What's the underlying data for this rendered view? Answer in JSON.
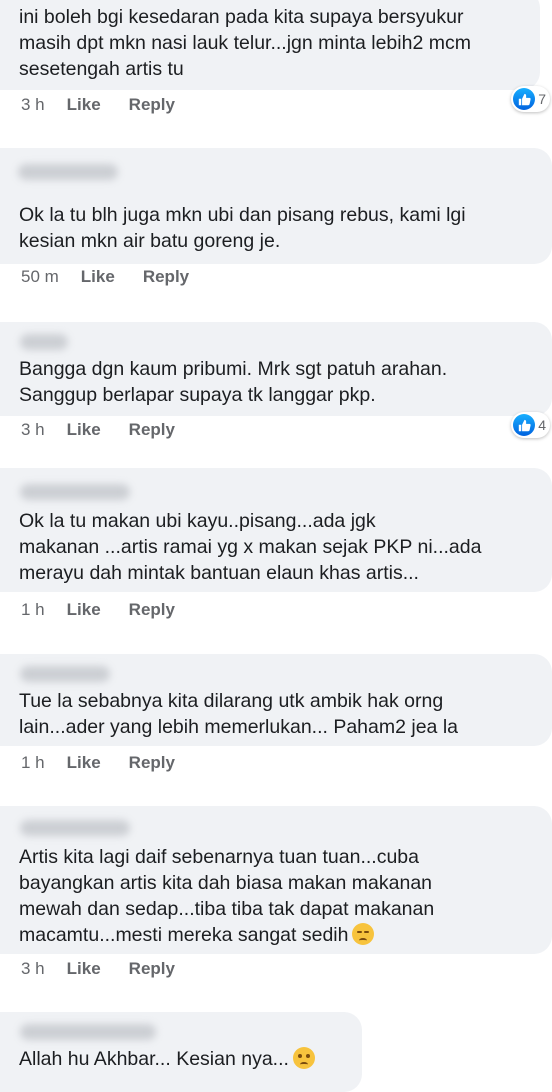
{
  "comments": [
    {
      "text": "ini boleh bgi kesedaran pada kita supaya bersyukur\nmasih dpt mkn nasi lauk telur...jgn minta lebih2 mcm\nsesetengah artis tu",
      "time": "3 h",
      "like": "Like",
      "reply": "Reply",
      "reaction_count": "7"
    },
    {
      "text": "Ok la tu blh juga mkn ubi dan pisang rebus, kami lgi\nkesian mkn air batu goreng je.",
      "time": "50 m",
      "like": "Like",
      "reply": "Reply"
    },
    {
      "text": "Bangga dgn kaum pribumi. Mrk sgt patuh arahan.\nSanggup berlapar supaya tk langgar pkp.",
      "time": "3 h",
      "like": "Like",
      "reply": "Reply",
      "reaction_count": "4"
    },
    {
      "text": "Ok la tu makan ubi kayu..pisang...ada jgk\nmakanan ...artis ramai yg x makan sejak PKP ni...ada\nmerayu dah mintak bantuan elaun khas artis...",
      "time": "1 h",
      "like": "Like",
      "reply": "Reply"
    },
    {
      "text": "Tue la sebabnya kita dilarang utk ambik hak orng\nlain...ader yang lebih memerlukan... Paham2 jea la",
      "time": "1 h",
      "like": "Like",
      "reply": "Reply"
    },
    {
      "text": "Artis kita lagi daif sebenarnya tuan tuan...cuba\nbayangkan artis kita dah biasa makan makanan\nmewah dan sedap...tiba tiba tak dapat makanan\nmacamtu...mesti mereka sangat sedih",
      "time": "3 h",
      "like": "Like",
      "reply": "Reply",
      "emoji": "pensive-face-icon"
    },
    {
      "text": "Allah hu Akhbar... Kesian nya...",
      "emoji": "worried-face-icon"
    }
  ],
  "colors": {
    "bubble": "#f0f2f5",
    "meta": "#65676b",
    "like_blue": "#1877f2"
  }
}
